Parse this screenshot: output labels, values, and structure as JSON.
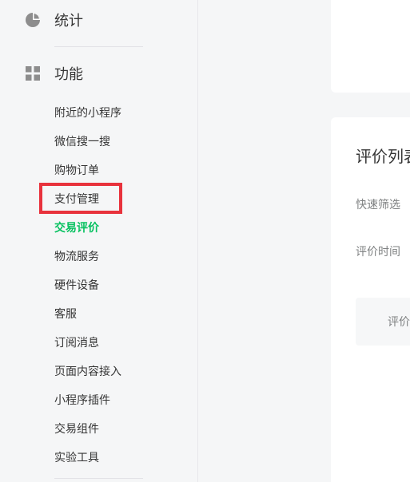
{
  "sidebar": {
    "stats": {
      "label": "统计",
      "icon": "pie-chart-icon"
    },
    "functions": {
      "label": "功能",
      "icon": "grid-icon"
    },
    "items": [
      {
        "label": "附近的小程序"
      },
      {
        "label": "微信搜一搜"
      },
      {
        "label": "购物订单"
      },
      {
        "label": "支付管理",
        "highlighted": true
      },
      {
        "label": "交易评价",
        "active": true
      },
      {
        "label": "物流服务"
      },
      {
        "label": "硬件设备"
      },
      {
        "label": "客服"
      },
      {
        "label": "订阅消息"
      },
      {
        "label": "页面内容接入"
      },
      {
        "label": "小程序插件"
      },
      {
        "label": "交易组件"
      },
      {
        "label": "实验工具"
      }
    ]
  },
  "main": {
    "title": "评价列表",
    "filters": {
      "quick_filter_label": "快速筛选",
      "time_label": "评价时间"
    },
    "table": {
      "first_header": "评价"
    }
  },
  "colors": {
    "active": "#07c160",
    "highlight_box": "#e8323c",
    "sidebar_bg": "#f5f6f7"
  }
}
